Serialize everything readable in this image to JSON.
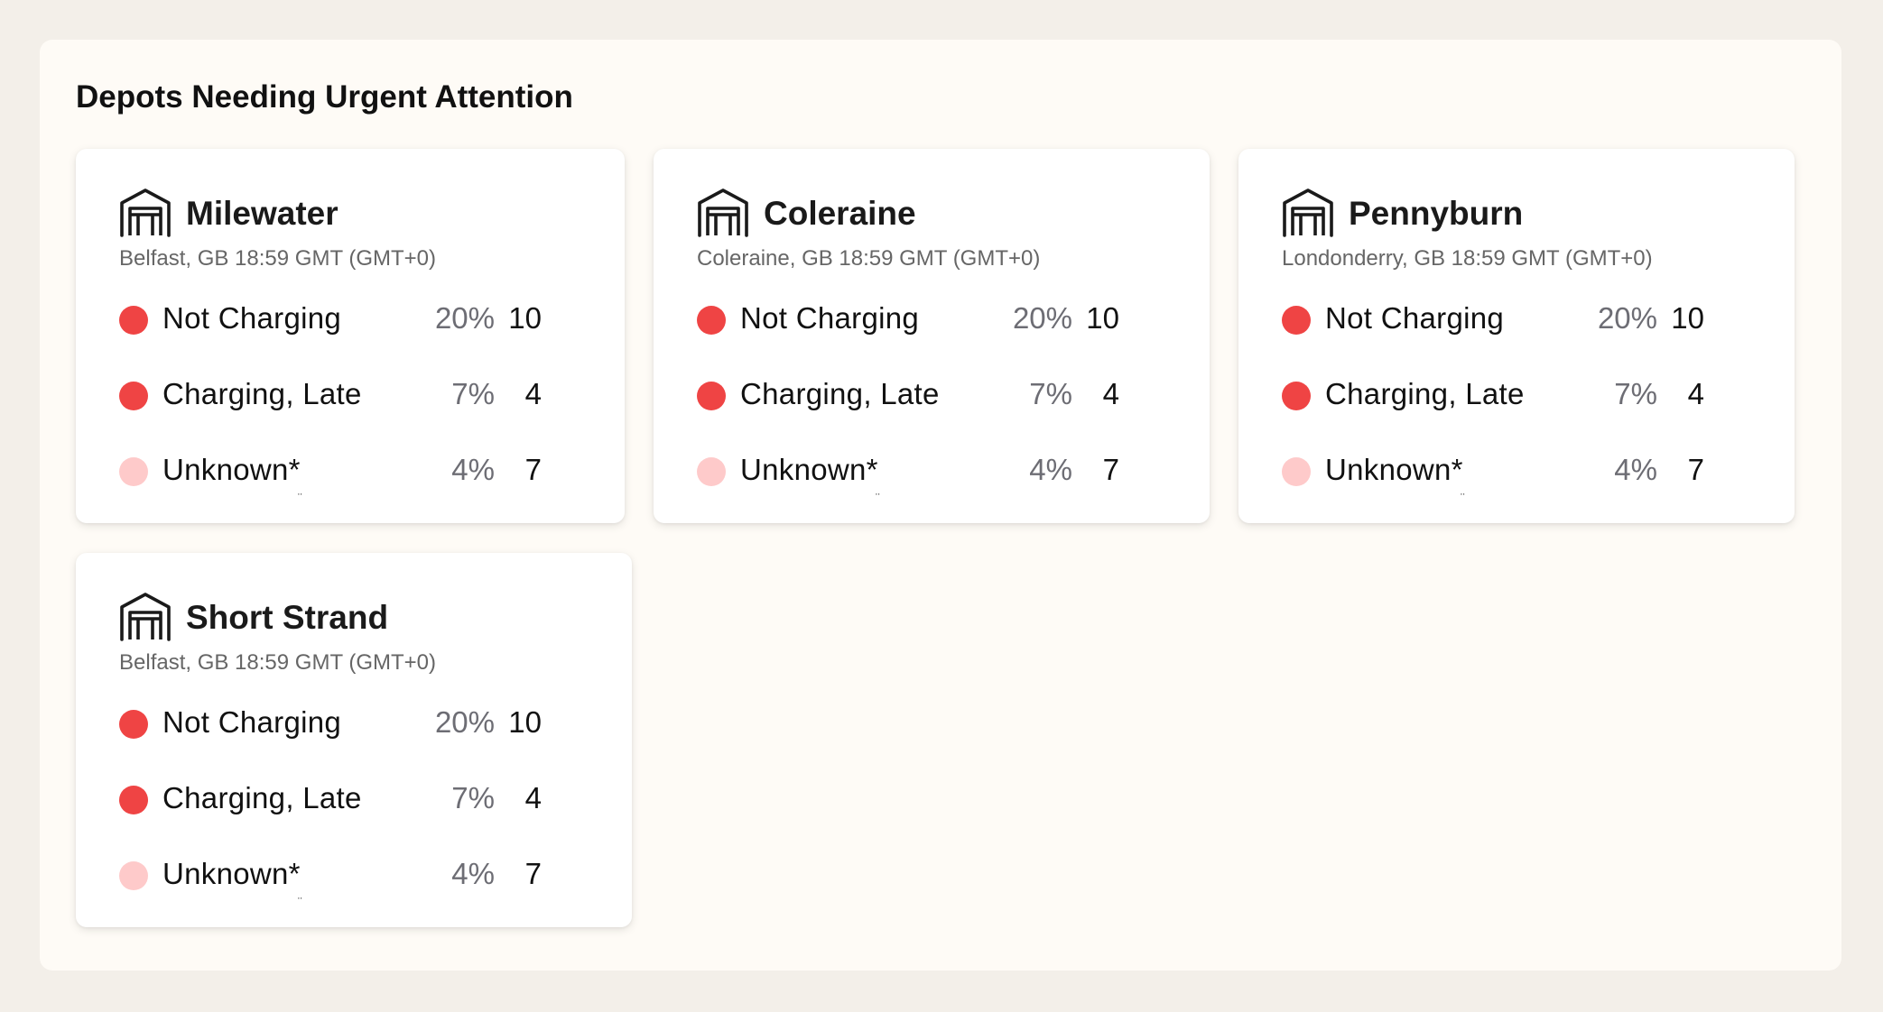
{
  "panel": {
    "title": "Depots Needing Urgent Attention"
  },
  "colors": {
    "red": "#ef4444",
    "light_red": "#fecaca"
  },
  "depots": [
    {
      "name": "Milewater",
      "meta": "Belfast, GB 18:59 GMT (GMT+0)",
      "icon": "garage-icon",
      "statuses": [
        {
          "label": "Not Charging",
          "pct": "20%",
          "count": "10",
          "color": "#ef4444"
        },
        {
          "label": "Charging, Late",
          "pct": "7%",
          "count": "4",
          "color": "#ef4444"
        },
        {
          "label": "Unknown*",
          "pct": "4%",
          "count": "7",
          "color": "#fecaca"
        }
      ]
    },
    {
      "name": "Coleraine",
      "meta": "Coleraine, GB 18:59 GMT (GMT+0)",
      "icon": "garage-icon",
      "statuses": [
        {
          "label": "Not Charging",
          "pct": "20%",
          "count": "10",
          "color": "#ef4444"
        },
        {
          "label": "Charging, Late",
          "pct": "7%",
          "count": "4",
          "color": "#ef4444"
        },
        {
          "label": "Unknown*",
          "pct": "4%",
          "count": "7",
          "color": "#fecaca"
        }
      ]
    },
    {
      "name": "Pennyburn",
      "meta": "Londonderry, GB 18:59 GMT (GMT+0)",
      "icon": "garage-icon",
      "statuses": [
        {
          "label": "Not Charging",
          "pct": "20%",
          "count": "10",
          "color": "#ef4444"
        },
        {
          "label": "Charging, Late",
          "pct": "7%",
          "count": "4",
          "color": "#ef4444"
        },
        {
          "label": "Unknown*",
          "pct": "4%",
          "count": "7",
          "color": "#fecaca"
        }
      ]
    },
    {
      "name": "Short Strand",
      "meta": "Belfast, GB 18:59 GMT (GMT+0)",
      "icon": "garage-icon",
      "statuses": [
        {
          "label": "Not Charging",
          "pct": "20%",
          "count": "10",
          "color": "#ef4444"
        },
        {
          "label": "Charging, Late",
          "pct": "7%",
          "count": "4",
          "color": "#ef4444"
        },
        {
          "label": "Unknown*",
          "pct": "4%",
          "count": "7",
          "color": "#fecaca"
        }
      ]
    }
  ]
}
